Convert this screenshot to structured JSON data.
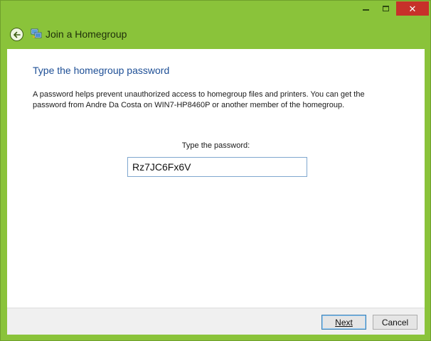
{
  "window": {
    "title": "Join a Homegroup",
    "controls": {
      "minimize_icon": "minimize-icon",
      "maximize_icon": "maximize-icon",
      "close_glyph": "✕"
    },
    "colors": {
      "frame": "#8ac33a",
      "close": "#c7312a",
      "heading": "#1e4f96"
    }
  },
  "main": {
    "heading": "Type the homegroup password",
    "description": "A password helps prevent unauthorized access to homegroup files and printers. You can get the password from Andre Da Costa on WIN7-HP8460P or another member of the homegroup.",
    "password_label": "Type the password:",
    "password_value": "Rz7JC6Fx6V"
  },
  "footer": {
    "next_label": "Next",
    "cancel_label": "Cancel"
  }
}
